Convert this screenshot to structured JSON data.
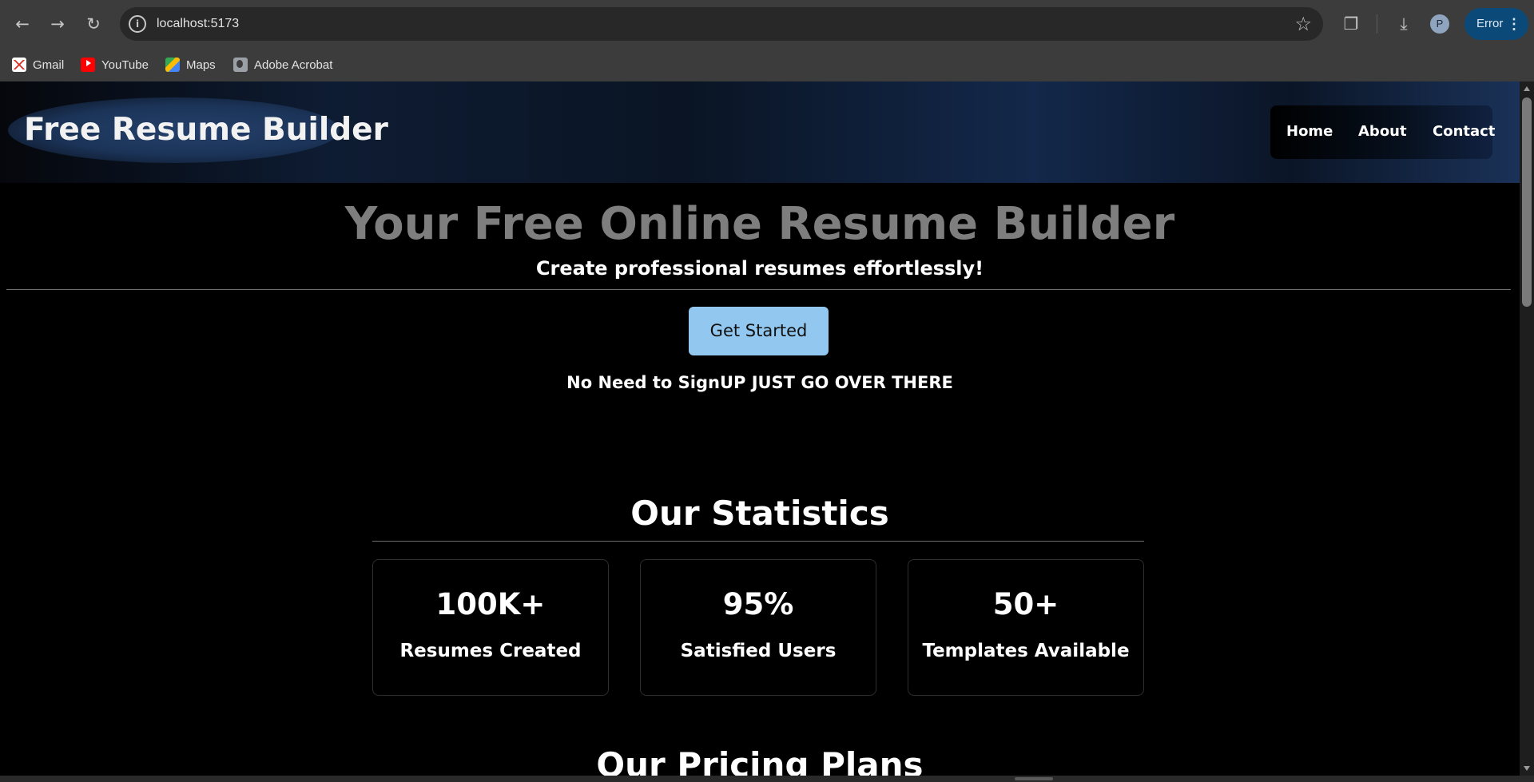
{
  "browser": {
    "url": "localhost:5173",
    "profile_initial": "P",
    "status_label": "Error",
    "bookmarks": [
      {
        "label": "Gmail",
        "icon": "gmail-icon"
      },
      {
        "label": "YouTube",
        "icon": "youtube-icon"
      },
      {
        "label": "Maps",
        "icon": "maps-icon"
      },
      {
        "label": "Adobe Acrobat",
        "icon": "globe-icon"
      }
    ],
    "accent_color": "#0b4a78"
  },
  "site": {
    "logo": "Free Resume Builder",
    "nav": [
      {
        "label": "Home"
      },
      {
        "label": "About"
      },
      {
        "label": "Contact"
      }
    ]
  },
  "hero": {
    "title": "Your Free Online Resume Builder",
    "subtitle": "Create professional resumes effortlessly!",
    "cta_label": "Get Started",
    "cta_color": "#92c8ef",
    "note": "No Need to SignUP JUST GO OVER THERE"
  },
  "stats": {
    "heading": "Our Statistics",
    "items": [
      {
        "value": "100K+",
        "label": "Resumes Created"
      },
      {
        "value": "95%",
        "label": "Satisfied Users"
      },
      {
        "value": "50+",
        "label": "Templates Available"
      }
    ]
  },
  "pricing": {
    "heading": "Our Pricing Plans"
  }
}
